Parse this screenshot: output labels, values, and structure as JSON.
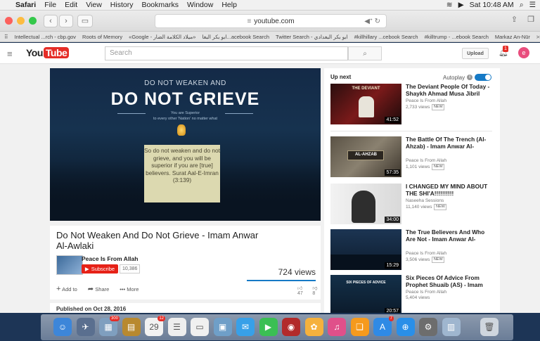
{
  "menubar": {
    "apple_glyph": "",
    "items": [
      "Safari",
      "File",
      "Edit",
      "View",
      "History",
      "Bookmarks",
      "Window",
      "Help"
    ],
    "status": {
      "battery": "▶",
      "datetime": "Sat 10:48 AM",
      "search": "⌕",
      "list": "☰"
    }
  },
  "browser": {
    "url": "youtube.com",
    "lock_glyph": "≡",
    "favorites": [
      "Intellectual ...rch - cbp.gov",
      "Roots of Memory",
      "«Google - ميلاد الكلامة الضار»",
      "ابو بكر البغا...acebook Search",
      "Twitter Search - ابو بكر البغدادي",
      "#killhillary ...cebook Search",
      "#killtrump - ...ebook Search",
      "Markaz An-Nūr",
      ">>"
    ]
  },
  "youtube": {
    "logo_you": "You",
    "logo_tube": "Tube",
    "search_placeholder": "Search",
    "upload_label": "Upload",
    "notification_count": "1",
    "avatar_letter": "e"
  },
  "video": {
    "thumb_line1": "DO NOT WEAKEN AND",
    "thumb_line2": "DO NOT GRIEVE",
    "thumb_line3": "You are Superior",
    "thumb_line4": "to every other 'Nation' no matter what",
    "quote": "So do not weaken and do not grieve, and you will be superior if you are [true] believers. Surat Aal-E-Imran (3:139)",
    "title": "Do Not Weaken And Do Not Grieve - Imam Anwar Al-Awlaki",
    "channel": "Peace Is From Allah",
    "subscribe_label": "Subscribe",
    "subscriber_count": "10,386",
    "views": "724 views",
    "actions": {
      "add_to": "Add to",
      "share": "Share",
      "more": "More"
    },
    "likes": "47",
    "dislikes": "8",
    "published": "Published on Oct 28, 2016"
  },
  "sidebar": {
    "up_next": "Up next",
    "autoplay_label": "Autoplay",
    "items": [
      {
        "title": "The Deviant People Of Today - Shaykh Ahmad Musa Jibril",
        "channel": "Peace Is From Allah",
        "views": "2,733 views",
        "badge": "NEW",
        "duration": "41:52",
        "thumb_text": "THE DEVIANT"
      },
      {
        "title": "The Battle Of The Trench (Al-Ahzab) - Imam Anwar Al-",
        "channel": "Peace Is From Allah",
        "views": "1,101 views",
        "badge": "NEW",
        "duration": "57:35",
        "thumb_text": "AL-AHZAB"
      },
      {
        "title": "I CHANGED MY MIND ABOUT THE SHI'A!!!!!!!!!!",
        "channel": "Naseeha Sessions",
        "views": "11,140 views",
        "badge": "NEW",
        "duration": "34:00",
        "thumb_text": ""
      },
      {
        "title": "The True Believers And Who Are Not - Imam Anwar Al-",
        "channel": "Peace Is From Allah",
        "views": "3,506 views",
        "badge": "NEW",
        "duration": "15:29",
        "thumb_text": ""
      },
      {
        "title": "Six Pieces Of Advice From Prophet Shuaib (AS) - Imam",
        "channel": "Peace Is From Allah",
        "views": "5,404 views",
        "badge": "",
        "duration": "20:57",
        "thumb_text": "SIX PIECES OF ADVICE"
      }
    ]
  },
  "dock": {
    "icons": [
      {
        "name": "finder-icon",
        "glyph": "☺",
        "color": "#3d86d9"
      },
      {
        "name": "launchpad-icon",
        "glyph": "✈",
        "color": "#5a6f8f"
      },
      {
        "name": "photos-browser-icon",
        "glyph": "▦",
        "color": "#7f9fbf",
        "badge": "300"
      },
      {
        "name": "notes-icon",
        "glyph": "▤",
        "color": "#b8892f"
      },
      {
        "name": "calendar-icon",
        "glyph": "29",
        "color": "#f2f2f2",
        "badge": "12"
      },
      {
        "name": "reminders-icon",
        "glyph": "☰",
        "color": "#eeeeee"
      },
      {
        "name": "stickies-icon",
        "glyph": "▭",
        "color": "#f0f0f0"
      },
      {
        "name": "preview-icon",
        "glyph": "▣",
        "color": "#6f9fc8"
      },
      {
        "name": "messages-icon",
        "glyph": "✉",
        "color": "#38a0e8"
      },
      {
        "name": "facetime-icon",
        "glyph": "▶",
        "color": "#3bbf54"
      },
      {
        "name": "photo-booth-icon",
        "glyph": "◉",
        "color": "#b22b2b"
      },
      {
        "name": "photos-icon",
        "glyph": "✿",
        "color": "#f5b13d"
      },
      {
        "name": "itunes-icon",
        "glyph": "♫",
        "color": "#e0508a"
      },
      {
        "name": "ibooks-icon",
        "glyph": "❑",
        "color": "#f59a1d"
      },
      {
        "name": "app-store-icon",
        "glyph": "A",
        "color": "#2f8ae5",
        "badge": "7"
      },
      {
        "name": "safari-icon",
        "glyph": "⊕",
        "color": "#2a8fe8"
      },
      {
        "name": "system-preferences-icon",
        "glyph": "⚙",
        "color": "#6d6d6d"
      },
      {
        "name": "finder-window-icon",
        "glyph": "▥",
        "color": "#9fb6cf"
      },
      {
        "name": "trash-icon",
        "glyph": "🗑",
        "color": "#cfd6de"
      }
    ]
  },
  "colors": {
    "youtube_red": "#e52d27",
    "link_blue": "#167ac6"
  }
}
